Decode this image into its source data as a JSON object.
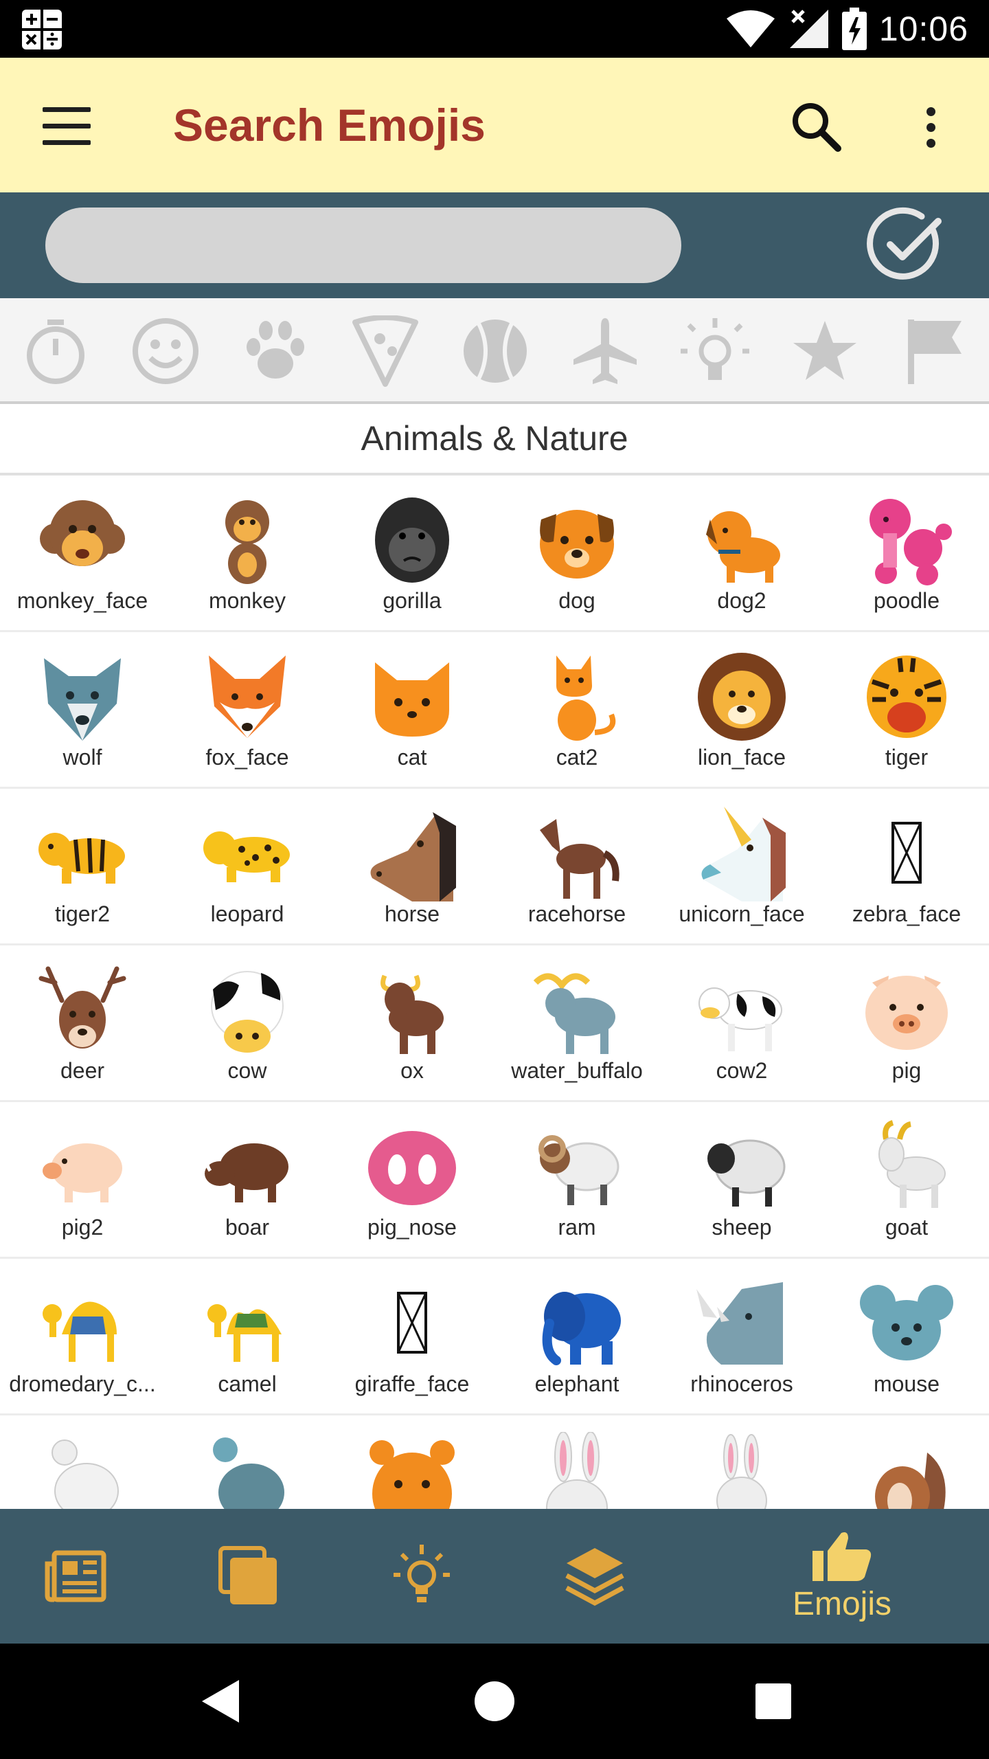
{
  "status_bar": {
    "time": "10:06"
  },
  "app_bar": {
    "title": "Search Emojis"
  },
  "search": {
    "value": "",
    "placeholder": ""
  },
  "categories": [
    {
      "name": "recent-icon"
    },
    {
      "name": "smiley-icon"
    },
    {
      "name": "paw-icon"
    },
    {
      "name": "pizza-icon"
    },
    {
      "name": "ball-icon"
    },
    {
      "name": "airplane-icon"
    },
    {
      "name": "lightbulb-icon"
    },
    {
      "name": "star-icon"
    },
    {
      "name": "flag-icon"
    }
  ],
  "section": {
    "title": "Animals & Nature"
  },
  "emoji_rows": [
    [
      "monkey_face",
      "monkey",
      "gorilla",
      "dog",
      "dog2",
      "poodle"
    ],
    [
      "wolf",
      "fox_face",
      "cat",
      "cat2",
      "lion_face",
      "tiger"
    ],
    [
      "tiger2",
      "leopard",
      "horse",
      "racehorse",
      "unicorn_face",
      "zebra_face"
    ],
    [
      "deer",
      "cow",
      "ox",
      "water_buffalo",
      "cow2",
      "pig"
    ],
    [
      "pig2",
      "boar",
      "pig_nose",
      "ram",
      "sheep",
      "goat"
    ],
    [
      "dromedary_c...",
      "camel",
      "giraffe_face",
      "elephant",
      "rhinoceros",
      "mouse"
    ],
    [
      "",
      "",
      "",
      "",
      "",
      ""
    ]
  ],
  "bottom_nav": {
    "items": [
      {
        "icon": "newspaper-icon"
      },
      {
        "icon": "copy-icon"
      },
      {
        "icon": "lightbulb-icon"
      },
      {
        "icon": "layers-icon"
      },
      {
        "icon": "thumbs-up-icon",
        "label": "Emojis"
      }
    ],
    "accent": "#f3d16a"
  },
  "colors": {
    "app_bar_bg": "#fff6b8",
    "title": "#a3352a",
    "strip_bg": "#3c5a68"
  }
}
